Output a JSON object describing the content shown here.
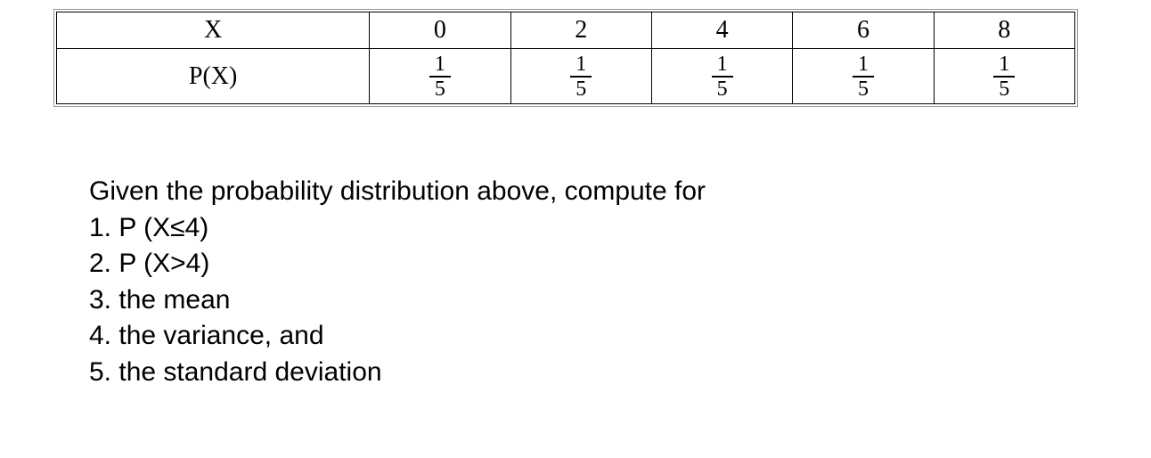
{
  "table": {
    "row_header_x": "X",
    "row_header_px": "P(X)",
    "x_values": [
      "0",
      "2",
      "4",
      "6",
      "8"
    ],
    "p_values": [
      {
        "num": "1",
        "den": "5"
      },
      {
        "num": "1",
        "den": "5"
      },
      {
        "num": "1",
        "den": "5"
      },
      {
        "num": "1",
        "den": "5"
      },
      {
        "num": "1",
        "den": "5"
      }
    ]
  },
  "prompt": {
    "intro": "Given the probability distribution above, compute for",
    "items": [
      "1. P (X≤4)",
      "2. P (X>4)",
      "3. the mean",
      "4. the variance, and",
      "5. the standard deviation"
    ]
  },
  "chart_data": {
    "type": "table",
    "title": "Discrete probability distribution",
    "columns": [
      "X",
      "P(X)"
    ],
    "rows": [
      {
        "X": 0,
        "P(X)": 0.2
      },
      {
        "X": 2,
        "P(X)": 0.2
      },
      {
        "X": 4,
        "P(X)": 0.2
      },
      {
        "X": 6,
        "P(X)": 0.2
      },
      {
        "X": 8,
        "P(X)": 0.2
      }
    ]
  }
}
